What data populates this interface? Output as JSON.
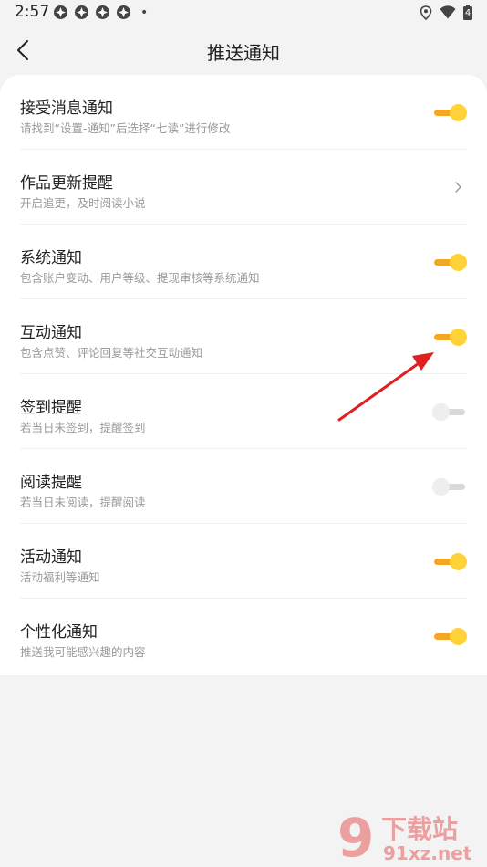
{
  "status_bar": {
    "time": "2:57",
    "dot": "•",
    "battery": "4"
  },
  "header": {
    "back_icon": "chevron-left-icon",
    "title": "推送通知"
  },
  "settings": [
    {
      "title": "接受消息通知",
      "subtitle": "请找到“设置-通知”后选择“七读”进行修改",
      "control": "toggle",
      "on": true
    },
    {
      "title": "作品更新提醒",
      "subtitle": "开启追更，及时阅读小说",
      "control": "chevron",
      "on": null
    },
    {
      "title": "系统通知",
      "subtitle": "包含账户变动、用户等级、提现审核等系统通知",
      "control": "toggle",
      "on": true
    },
    {
      "title": "互动通知",
      "subtitle": "包含点赞、评论回复等社交互动通知",
      "control": "toggle",
      "on": true
    },
    {
      "title": "签到提醒",
      "subtitle": "若当日未签到，提醒签到",
      "control": "toggle",
      "on": false
    },
    {
      "title": "阅读提醒",
      "subtitle": "若当日未阅读，提醒阅读",
      "control": "toggle",
      "on": false
    },
    {
      "title": "活动通知",
      "subtitle": "活动福利等通知",
      "control": "toggle",
      "on": true
    },
    {
      "title": "个性化通知",
      "subtitle": "推送我可能感兴趣的内容",
      "control": "toggle",
      "on": true
    }
  ],
  "colors": {
    "toggle_on_track": "#f5a623",
    "toggle_on_knob": "#ffd23a",
    "toggle_off_track": "#d9d9d9",
    "toggle_off_knob": "#eeeeee",
    "annotation_arrow": "#e02020"
  },
  "watermark": {
    "logo_text": "9",
    "brand": "下载站",
    "site": "91xz.net"
  }
}
